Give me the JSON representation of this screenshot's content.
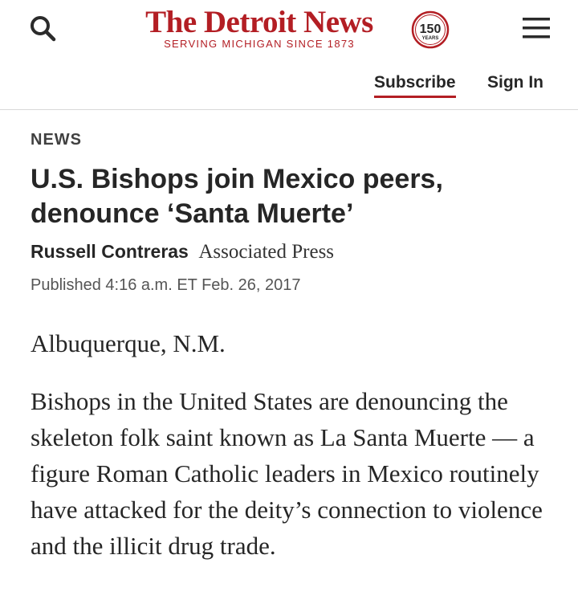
{
  "header": {
    "logo_title": "The Detroit News",
    "logo_tagline": "SERVING MICHIGAN SINCE 1873",
    "anniversary_number": "150",
    "anniversary_label": "YEARS",
    "brand_color": "#b31e24",
    "search_icon": "search-icon",
    "menu_icon": "hamburger-menu-icon"
  },
  "auth": {
    "subscribe_label": "Subscribe",
    "signin_label": "Sign In"
  },
  "article": {
    "section": "NEWS",
    "headline": "U.S. Bishops join Mexico peers, denounce ‘Santa Muerte’",
    "author": "Russell Contreras",
    "agency": "Associated Press",
    "published": "Published 4:16 a.m. ET Feb. 26, 2017",
    "dateline": "Albuquerque, N.M.",
    "paragraph_1": "Bishops in the United States are denouncing the skeleton folk saint known as La Santa Muerte — a figure Roman Catholic leaders in Mexico routinely have attacked for the deity’s connection to violence and the illicit drug trade."
  }
}
